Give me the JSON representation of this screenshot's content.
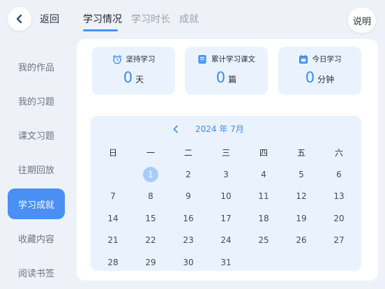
{
  "header": {
    "back_label": "返回",
    "info_label": "说明",
    "tabs": [
      {
        "label": "学习情况"
      },
      {
        "label": "学习时长"
      },
      {
        "label": "成就"
      }
    ]
  },
  "sidebar": {
    "items": [
      {
        "label": "我的作品"
      },
      {
        "label": "我的习题"
      },
      {
        "label": "课文习题"
      },
      {
        "label": "往期回放"
      },
      {
        "label": "学习成就"
      },
      {
        "label": "收藏内容"
      },
      {
        "label": "阅读书签"
      }
    ],
    "active_index": 4
  },
  "stats": [
    {
      "label": "坚持学习",
      "value": "0",
      "unit": "天",
      "icon": "alarm-clock-icon"
    },
    {
      "label": "累计学习课文",
      "value": "0",
      "unit": "篇",
      "icon": "book-icon"
    },
    {
      "label": "今日学习",
      "value": "0",
      "unit": "分钟",
      "icon": "calendar-icon"
    }
  ],
  "calendar": {
    "month_label": "2024 年 7月",
    "weekdays": [
      "日",
      "一",
      "二",
      "三",
      "四",
      "五",
      "六"
    ],
    "first_weekday": 1,
    "days_in_month": 31,
    "highlighted_day": 1
  },
  "colors": {
    "accent": "#4a90f4",
    "stat_number": "#3c8cf2",
    "card_bg": "#eaf3fd",
    "page_bg": "#eef2f8"
  }
}
